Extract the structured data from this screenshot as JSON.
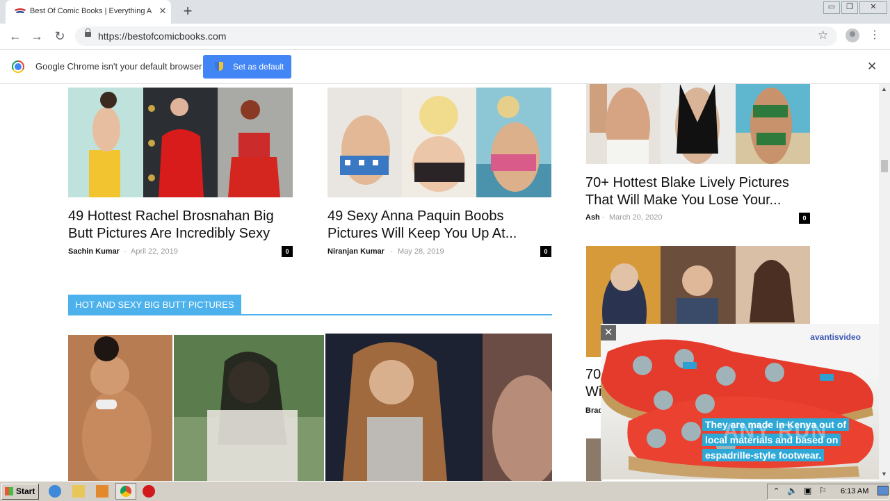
{
  "browser": {
    "tab_title": "Best Of Comic Books | Everything Ab",
    "tab_close": "✕",
    "new_tab": "+",
    "url": "https://bestofcomicbooks.com",
    "window_controls": [
      "▭",
      "❐",
      "✕"
    ]
  },
  "infobar": {
    "message": "Google Chrome isn't your default browser",
    "button": "Set as default",
    "close": "✕"
  },
  "articles": [
    {
      "title": "49 Hottest Rachel Brosnahan Big Butt Pictures Are Incredibly Sexy",
      "author": "Sachin Kumar",
      "date": "April 22, 2019",
      "comments": "0"
    },
    {
      "title": "49 Sexy Anna Paquin Boobs Pictures Will Keep You Up At...",
      "author": "Niranjan Kumar",
      "date": "May 28, 2019",
      "comments": "0"
    }
  ],
  "sidebar_articles": [
    {
      "title": "70+ Hottest Blake Lively Pictures That Will Make You Lose Your...",
      "author": "Ash",
      "date": "March 20, 2020",
      "comments": "0"
    },
    {
      "title_partial_1": "70",
      "title_partial_2": "Wi",
      "author_partial": "Brad"
    }
  ],
  "section": {
    "header": "HOT AND SEXY BIG BUTT PICTURES"
  },
  "ad": {
    "brand": "avantisvideo",
    "close": "✕",
    "caption_line1": "They are made in Kenya out of",
    "caption_line2": "local materials and based on",
    "caption_line3": "espadrille-style footwear.",
    "watermark": "ANY RUN"
  },
  "taskbar": {
    "start": "Start",
    "clock": "6:13 AM"
  },
  "colors": {
    "accent": "#4db2ec",
    "chrome_blue": "#4285f4",
    "ad_brand": "#3b56b3"
  }
}
